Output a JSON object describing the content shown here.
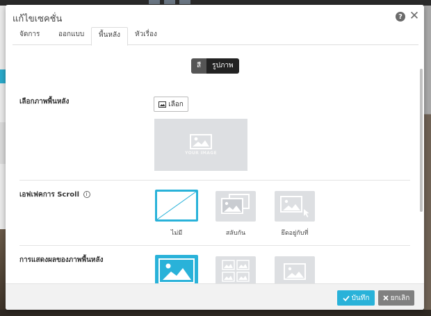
{
  "modal": {
    "title": "แก้ไขเซคชั่น"
  },
  "tabs": [
    {
      "label": "จัดการ"
    },
    {
      "label": "ออกแบบ"
    },
    {
      "label": "พื้นหลัง"
    },
    {
      "label": "หัวเรื่อง"
    }
  ],
  "toggle": {
    "color_label": "สี",
    "image_label": "รูปภาพ",
    "selected": "รูปภาพ"
  },
  "background_image": {
    "label": "เลือกภาพพื้นหลัง",
    "select_label": "เลือก",
    "placeholder_text": "YOUR IMAGE"
  },
  "scroll_effect": {
    "label": "เอฟเฟคการ Scroll",
    "info_glyph": "i",
    "options": [
      {
        "label": "ไม่มี",
        "selected": true
      },
      {
        "label": "สลับกัน",
        "selected": false
      },
      {
        "label": "ยึดอยู่กับที่",
        "selected": false
      }
    ]
  },
  "display": {
    "label": "การแสดงผลของภาพพื้นหลัง",
    "options": [
      {
        "icon": "cover-image-icon",
        "selected": true
      },
      {
        "icon": "tile-image-icon",
        "selected": false
      },
      {
        "icon": "center-image-icon",
        "selected": false
      }
    ]
  },
  "footer": {
    "save_label": "บันทึก",
    "cancel_label": "ยกเลิก"
  },
  "colors": {
    "accent": "#29b2d9",
    "cancel": "#808080",
    "placeholder": "#dddfe2"
  }
}
